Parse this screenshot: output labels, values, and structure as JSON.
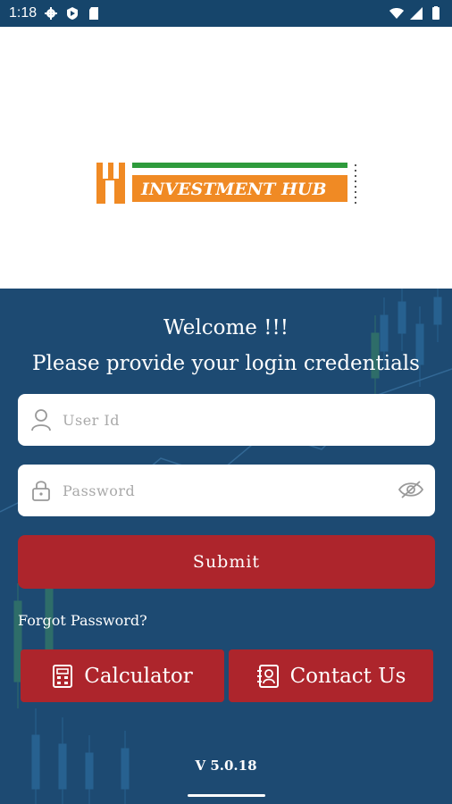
{
  "status_bar": {
    "time": "1:18",
    "icons": [
      "gear-icon",
      "play-protect-icon",
      "sd-card-icon",
      "wifi-icon",
      "signal-icon",
      "battery-icon"
    ]
  },
  "logo": {
    "text": "Investment Hub"
  },
  "welcome": {
    "line1": "Welcome !!!",
    "line2": "Please provide your login credentials"
  },
  "form": {
    "user_id_placeholder": "User Id",
    "password_placeholder": "Password",
    "submit_label": "Submit",
    "forgot_label": "Forgot Password?"
  },
  "actions": {
    "calculator_label": "Calculator",
    "contact_label": "Contact Us"
  },
  "footer": {
    "version": "V 5.0.18"
  },
  "colors": {
    "primary_blue": "#1d4a72",
    "button_red": "#ad252c",
    "logo_orange": "#f08a24",
    "logo_green": "#2e9b3c"
  }
}
